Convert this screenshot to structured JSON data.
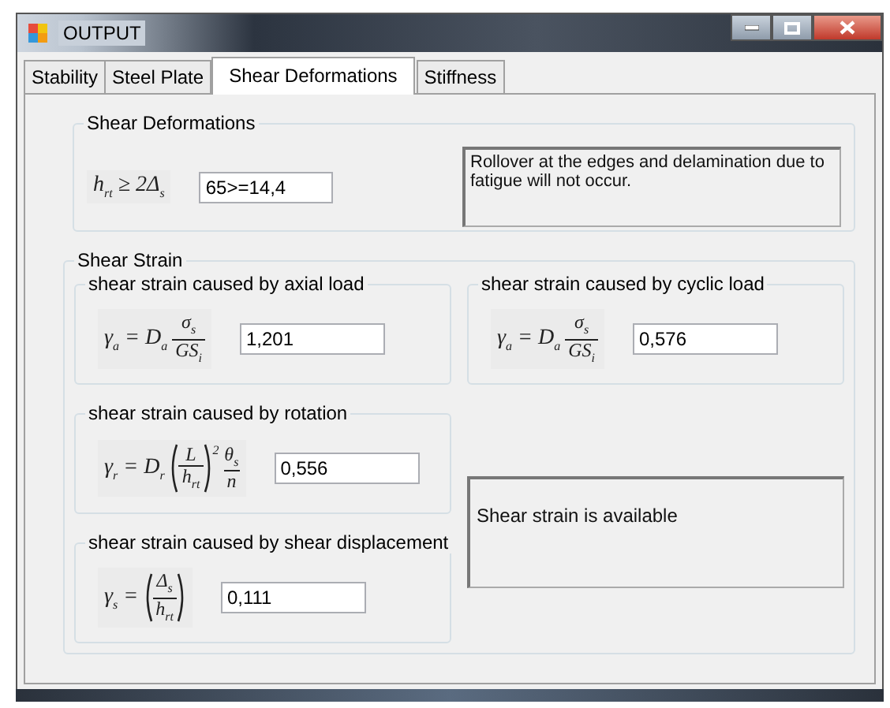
{
  "window": {
    "title": "OUTPUT"
  },
  "tabs": [
    {
      "label": "Stability",
      "selected": false
    },
    {
      "label": "Steel Plate",
      "selected": false
    },
    {
      "label": "Shear Deformations",
      "selected": true
    },
    {
      "label": "Stiffness",
      "selected": false
    }
  ],
  "shear_deformations": {
    "title": "Shear Deformations",
    "formula": [
      {
        "kind": "text",
        "text": "h$_{rt}$ ≥ 2Δ$_{s}$"
      }
    ],
    "value": "65>=14,4",
    "message": "Rollover at the edges and delamination due to fatigue will not occur."
  },
  "shear_strain": {
    "title": "Shear Strain",
    "groups": [
      {
        "title": "shear strain caused by axial load",
        "formula": [
          {
            "kind": "text",
            "text": "γ$_{a}$ = D$_{a}$"
          },
          {
            "kind": "frac",
            "num": "σ$_{s}$",
            "den": "GS$_{i}$"
          }
        ],
        "value": "1,201"
      },
      {
        "title": "shear strain caused by cyclic load",
        "formula": [
          {
            "kind": "text",
            "text": "γ$_{a}$ = D$_{a}$"
          },
          {
            "kind": "frac",
            "num": "σ$_{s}$",
            "den": "GS$_{i}$"
          }
        ],
        "value": "0,576"
      },
      {
        "title": "shear strain caused by rotation",
        "formula": [
          {
            "kind": "text",
            "text": "γ$_{r}$ = D$_{r}$"
          },
          {
            "kind": "paren",
            "parts": [
              {
                "kind": "frac",
                "num": "L",
                "den": "h$_{rt}$"
              }
            ],
            "sup": "2"
          },
          {
            "kind": "frac",
            "num": "θ$_{s}$",
            "den": "n"
          }
        ],
        "value": "0,556"
      },
      {
        "title": "shear strain caused by shear displacement",
        "formula": [
          {
            "kind": "text",
            "text": "γ$_{s}$ ="
          },
          {
            "kind": "paren",
            "parts": [
              {
                "kind": "frac",
                "num": "Δ$_{s}$",
                "den": "h$_{rt}$"
              }
            ]
          }
        ],
        "value": "0,111"
      }
    ],
    "message": "Shear strain is available"
  }
}
